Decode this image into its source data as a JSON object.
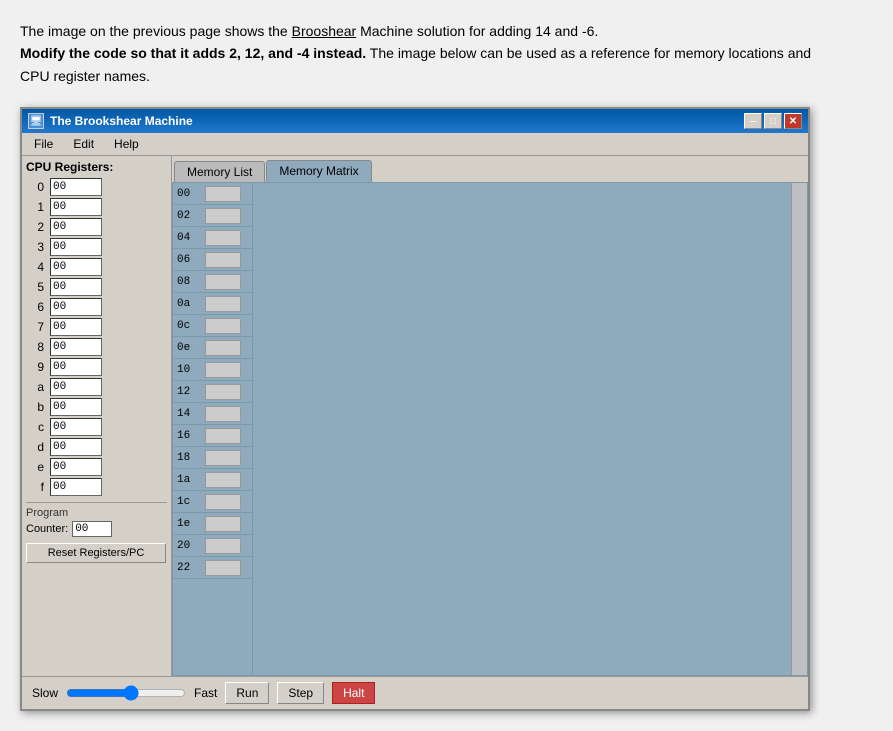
{
  "page": {
    "paragraph1": "The image on the previous page shows the Brooshear Machine solution for adding 14 and -6.",
    "paragraph1_bold": "Modify the code so that it adds 2, 12, and -4 instead.",
    "paragraph1_cont": " The image below can be used as a reference for memory locations and CPU register names.",
    "window_title": "The Brookshear Machine",
    "menu": {
      "file": "File",
      "edit": "Edit",
      "help": "Help"
    },
    "cpu_panel": {
      "title": "CPU Registers:",
      "registers": [
        {
          "label": "0",
          "value": "00"
        },
        {
          "label": "1",
          "value": "00"
        },
        {
          "label": "2",
          "value": "00"
        },
        {
          "label": "3",
          "value": "00"
        },
        {
          "label": "4",
          "value": "00"
        },
        {
          "label": "5",
          "value": "00"
        },
        {
          "label": "6",
          "value": "00"
        },
        {
          "label": "7",
          "value": "00"
        },
        {
          "label": "8",
          "value": "00"
        },
        {
          "label": "9",
          "value": "00"
        },
        {
          "label": "a",
          "value": "00"
        },
        {
          "label": "b",
          "value": "00"
        },
        {
          "label": "c",
          "value": "00"
        },
        {
          "label": "d",
          "value": "00"
        },
        {
          "label": "e",
          "value": "00"
        },
        {
          "label": "f",
          "value": "00"
        }
      ],
      "program_label": "Program",
      "counter_label": "Counter:",
      "counter_value": "00",
      "reset_btn": "Reset Registers/PC"
    },
    "tabs": [
      {
        "label": "Memory List",
        "active": false
      },
      {
        "label": "Memory Matrix",
        "active": true
      }
    ],
    "memory_addresses": [
      "00",
      "02",
      "04",
      "06",
      "08",
      "0a",
      "0c",
      "0e",
      "10",
      "12",
      "14",
      "16",
      "18",
      "1a",
      "1c",
      "1e",
      "20",
      "22"
    ],
    "bottom": {
      "slow_label": "Slow",
      "fast_label": "Fast",
      "run_btn": "Run",
      "step_btn": "Step",
      "halt_btn": "Halt"
    },
    "win_controls": {
      "minimize": "–",
      "restore": "□",
      "close": "✕"
    }
  }
}
